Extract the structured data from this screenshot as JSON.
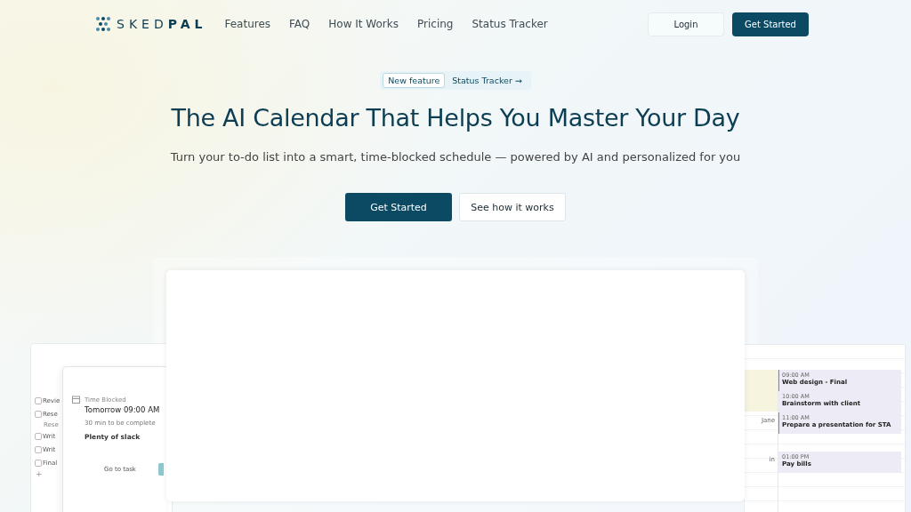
{
  "nav": {
    "logo": {
      "light": "SKED",
      "bold": "PAL"
    },
    "links": [
      "Features",
      "FAQ",
      "How It Works",
      "Pricing",
      "Status Tracker"
    ],
    "login": "Login",
    "cta": "Get Started"
  },
  "hero": {
    "badge": {
      "tag": "New feature",
      "link": "Status Tracker",
      "arrow": "→"
    },
    "title": "The AI Calendar That Helps You Master Your Day",
    "subtitle": "Turn your to-do list into a smart, time-blocked schedule — powered by AI and personalized for you",
    "buttons": [
      {
        "label": "Get Started",
        "kind": "primary"
      },
      {
        "label": "See how it works",
        "kind": "secondary"
      }
    ]
  },
  "preview": {
    "tasks": [
      {
        "text": "Revie",
        "kind": "task",
        "checked": false
      },
      {
        "text": "Rese",
        "kind": "task",
        "checked": false
      },
      {
        "text": "Rese",
        "kind": "note"
      },
      {
        "text": "Writ",
        "kind": "task",
        "checked": false
      },
      {
        "text": "Writ",
        "kind": "task",
        "checked": false
      },
      {
        "text": "Final",
        "kind": "task",
        "checked": false
      },
      {
        "text": "+",
        "kind": "add"
      }
    ],
    "popup": {
      "label": "Time Blocked",
      "time": "Tomorrow 09:00 AM",
      "note": "30 min to be complete",
      "slack": "Plenty of slack",
      "action": "Go to task"
    },
    "calendar": {
      "side_labels": [
        "Jane",
        "in"
      ],
      "events": [
        {
          "time": "09:00 AM",
          "title": "Web design - Final",
          "marked": true
        },
        {
          "time": "10:00 AM",
          "title": "Brainstorm with client",
          "marked": false
        },
        {
          "time": "11:00 AM",
          "title": "Prepare a presentation for STA",
          "marked": true
        },
        {
          "time": "01:00 PM",
          "title": "Pay bills",
          "marked": false
        }
      ]
    }
  }
}
